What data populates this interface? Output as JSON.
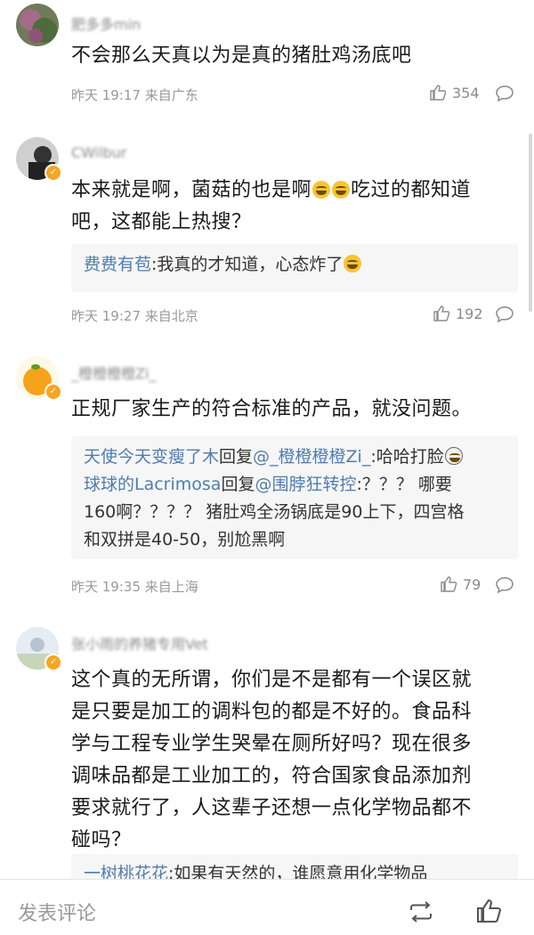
{
  "comments": [
    {
      "username": "肥多多min",
      "text": "不会那么天真以为是真的猪肚鸡汤底吧",
      "time": "昨天 19:17",
      "location": "来自广东",
      "likes": "354"
    },
    {
      "username": "CWilbur",
      "text_a": "本来就是啊，菌菇的也是啊",
      "text_b": "吃过的都知道",
      "text_c": "吧，这都能上热搜？",
      "reply_name": "费费有苞",
      "reply_text": ":我真的才知道，心态炸了",
      "time": "昨天 19:27",
      "location": "来自北京",
      "likes": "192"
    },
    {
      "username": "_橙橙橙橙Zi_",
      "text": "正规厂家生产的符合标准的产品，就没问题。",
      "reply1_name": "天使今天变瘦了木",
      "reply1_mid": "回复",
      "reply1_target": "@_橙橙橙橙Zi_",
      "reply1_text": ":哈哈打脸",
      "reply2_name": "球球的Lacrimosa",
      "reply2_mid": "回复",
      "reply2_target": "@围脖狂转控",
      "reply2_text_a": ":？？？ 哪要",
      "reply2_text_b": "160啊？？？？ 猪肚鸡全汤锅底是90上下，四宫格",
      "reply2_text_c": "和双拼是40-50，别尬黑啊",
      "time": "昨天 19:35",
      "location": "来自上海",
      "likes": "79"
    },
    {
      "username": "张小雨的养猪专用Vet",
      "text_a": "这个真的无所谓，你们是不是都有一个误区就",
      "text_b": "是只要是加工的调料包的都是不好的。食品科",
      "text_c": "学与工程专业学生哭晕在厕所好吗？现在很多",
      "text_d": "调味品都是工业加工的，符合国家食品添加剂",
      "text_e": "要求就行了，人这辈子还想一点化学物品都不",
      "text_f": "碰吗？",
      "reply_partial_name": "一树桃花花",
      "reply_partial_text": ":如果有天然的，谁愿意用化学物品"
    }
  ],
  "bottom": {
    "placeholder": "发表评论"
  },
  "icons": {
    "like": "thumbs-up-icon",
    "reply": "speech-bubble-icon",
    "repost": "repost-icon",
    "verified": "verified-badge-icon"
  },
  "colors": {
    "link": "#507daf",
    "meta": "#999999",
    "reply_bg": "#f6f6f6",
    "badge": "#f5a623"
  }
}
